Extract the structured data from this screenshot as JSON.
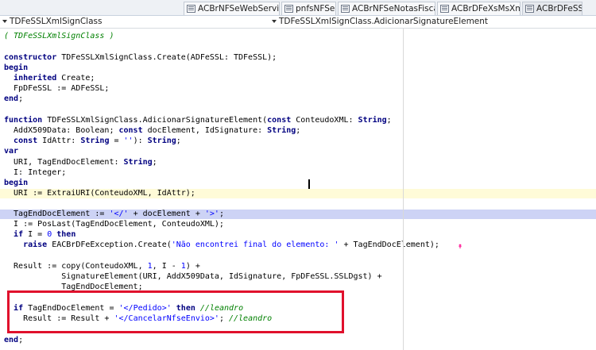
{
  "tabs": [
    {
      "label": "ACBrNFSeWebServices",
      "active": false
    },
    {
      "label": "pnfsNFSeG",
      "active": false
    },
    {
      "label": "ACBrNFSeNotasFiscais",
      "active": false
    },
    {
      "label": "ACBrDFeXsMsXml",
      "active": false
    },
    {
      "label": "ACBrDFeSSL",
      "active": true
    }
  ],
  "nav": {
    "class_name": "TDFeSSLXmlSignClass",
    "method_name": "TDFeSSLXmlSignClass.AdicionarSignatureElement"
  },
  "colors": {
    "keyword": "#000080",
    "comment": "#008000",
    "string": "#0000ff",
    "current_line": "#fffbd8",
    "selected_line": "#cdd3f5",
    "annotation_box": "#e0102c"
  },
  "lines": [
    [
      [
        "cm",
        "( TDFeSSLXmlSignClass )"
      ]
    ],
    [],
    [
      [
        "kw",
        "constructor"
      ],
      [
        "tx",
        " TDFeSSLXmlSignClass.Create(ADFeSSL: TDFeSSL);"
      ]
    ],
    [
      [
        "kw",
        "begin"
      ]
    ],
    [
      [
        "tx",
        "  "
      ],
      [
        "kw",
        "inherited"
      ],
      [
        "tx",
        " Create;"
      ]
    ],
    [
      [
        "tx",
        "  FpDFeSSL := ADFeSSL;"
      ]
    ],
    [
      [
        "kw",
        "end"
      ],
      [
        "tx",
        ";"
      ]
    ],
    [],
    [
      [
        "kw",
        "function"
      ],
      [
        "tx",
        " TDFeSSLXmlSignClass.AdicionarSignatureElement("
      ],
      [
        "kw",
        "const"
      ],
      [
        "tx",
        " ConteudoXML: "
      ],
      [
        "kw",
        "String"
      ],
      [
        "tx",
        ";"
      ]
    ],
    [
      [
        "tx",
        "  AddX509Data: Boolean; "
      ],
      [
        "kw",
        "const"
      ],
      [
        "tx",
        " docElement, IdSignature: "
      ],
      [
        "kw",
        "String"
      ],
      [
        "tx",
        ";"
      ]
    ],
    [
      [
        "tx",
        "  "
      ],
      [
        "kw",
        "const"
      ],
      [
        "tx",
        " IdAttr: "
      ],
      [
        "kw",
        "String"
      ],
      [
        "tx",
        " = "
      ],
      [
        "st",
        "''"
      ],
      [
        "tx",
        "): "
      ],
      [
        "kw",
        "String"
      ],
      [
        "tx",
        ";"
      ]
    ],
    [
      [
        "kw",
        "var"
      ]
    ],
    [
      [
        "tx",
        "  URI, TagEndDocElement: "
      ],
      [
        "kw",
        "String"
      ],
      [
        "tx",
        ";"
      ]
    ],
    [
      [
        "tx",
        "  I: Integer;"
      ]
    ],
    [
      [
        "kw",
        "begin"
      ]
    ],
    [
      [
        "tx",
        "  URI := ExtraiURI(ConteudoXML, IdAttr);"
      ]
    ],
    [],
    [
      [
        "tx",
        "  TagEndDocElement := "
      ],
      [
        "st",
        "'</'"
      ],
      [
        "tx",
        " + docElement + "
      ],
      [
        "st",
        "'>'"
      ],
      [
        "tx",
        ";"
      ]
    ],
    [
      [
        "tx",
        "  I := PosLast(TagEndDocElement, ConteudoXML);"
      ]
    ],
    [
      [
        "tx",
        "  "
      ],
      [
        "kw",
        "if"
      ],
      [
        "tx",
        " I = "
      ],
      [
        "nu",
        "0"
      ],
      [
        "tx",
        " "
      ],
      [
        "kw",
        "then"
      ]
    ],
    [
      [
        "tx",
        "    "
      ],
      [
        "kw",
        "raise"
      ],
      [
        "tx",
        " EACBrDFeException.Create("
      ],
      [
        "st",
        "'Não encontrei final do elemento: '"
      ],
      [
        "tx",
        " + TagEndDocElement);"
      ]
    ],
    [],
    [
      [
        "tx",
        "  Result := copy(ConteudoXML, "
      ],
      [
        "nu",
        "1"
      ],
      [
        "tx",
        ", I - "
      ],
      [
        "nu",
        "1"
      ],
      [
        "tx",
        ") +"
      ]
    ],
    [
      [
        "tx",
        "            SignatureElement(URI, AddX509Data, IdSignature, FpDFeSSL.SSLDgst) +"
      ]
    ],
    [
      [
        "tx",
        "            TagEndDocElement;"
      ]
    ],
    [],
    [
      [
        "tx",
        "  "
      ],
      [
        "kw",
        "if"
      ],
      [
        "tx",
        " TagEndDocElement = "
      ],
      [
        "st",
        "'</Pedido>'"
      ],
      [
        "tx",
        " "
      ],
      [
        "kw",
        "then"
      ],
      [
        "tx",
        " "
      ],
      [
        "cm",
        "//leandro"
      ]
    ],
    [
      [
        "tx",
        "    Result := Result + "
      ],
      [
        "st",
        "'</CancelarNfseEnvio>'"
      ],
      [
        "tx",
        "; "
      ],
      [
        "cm",
        "//leandro"
      ]
    ],
    [],
    [
      [
        "kw",
        "end"
      ],
      [
        "tx",
        ";"
      ]
    ]
  ]
}
